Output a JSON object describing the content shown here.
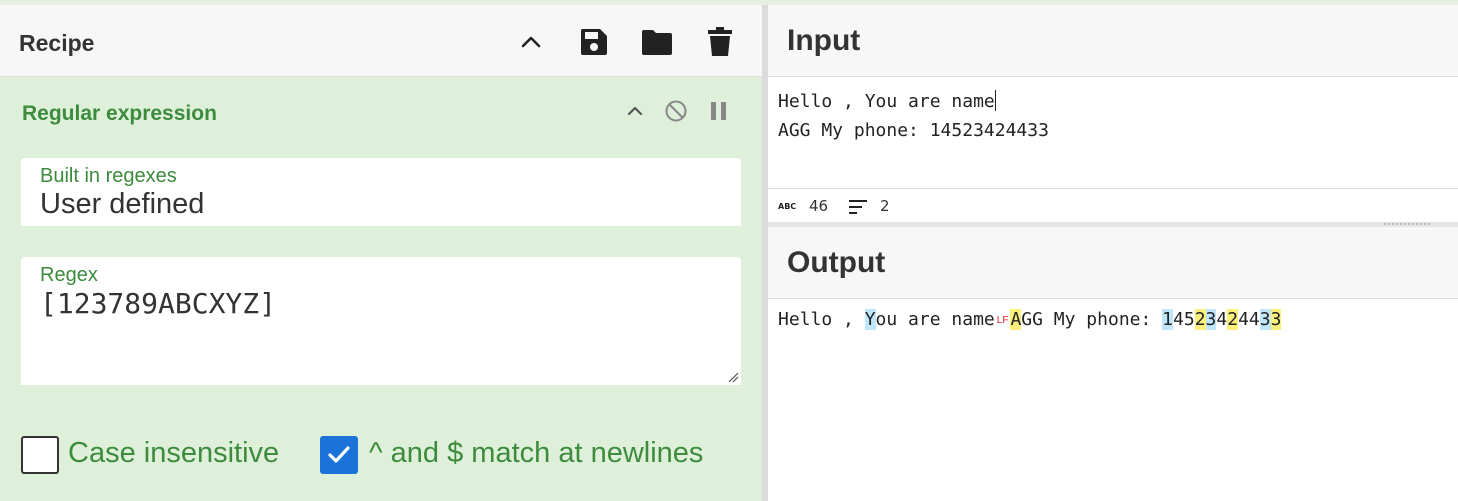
{
  "recipe": {
    "title": "Recipe",
    "header_icons": [
      "chevron-up-icon",
      "save-icon",
      "folder-icon",
      "trash-icon"
    ],
    "operation": {
      "title": "Regular expression",
      "icons": [
        "chevron-up-icon",
        "disable-icon",
        "pause-icon"
      ],
      "builtin": {
        "label": "Built in regexes",
        "value": "User defined"
      },
      "regex": {
        "label": "Regex",
        "value": "[123789ABCXYZ]"
      },
      "case_insensitive": {
        "label": "Case insensitive",
        "checked": false
      },
      "multiline": {
        "label": "^ and $ match at newlines",
        "checked": true
      }
    }
  },
  "input": {
    "title": "Input",
    "lines": [
      "Hello , You are name",
      "AGG My phone: 14523424433"
    ],
    "status": {
      "char_count": "46",
      "line_count": "2",
      "char_icon": "abc-icon",
      "lines_icon": "lines-icon"
    }
  },
  "output": {
    "title": "Output",
    "lf_marker": "LF",
    "segments": [
      {
        "text": "Hello , ",
        "hl": ""
      },
      {
        "text": "Y",
        "hl": "blue"
      },
      {
        "text": "ou are name",
        "hl": ""
      },
      {
        "text": "LF",
        "hl": "lf"
      },
      {
        "text": "A",
        "hl": "yellow"
      },
      {
        "text": "GG My phone: ",
        "hl": ""
      },
      {
        "text": "1",
        "hl": "blue"
      },
      {
        "text": "45",
        "hl": ""
      },
      {
        "text": "2",
        "hl": "yellow"
      },
      {
        "text": "3",
        "hl": "blue"
      },
      {
        "text": "4",
        "hl": ""
      },
      {
        "text": "2",
        "hl": "yellow"
      },
      {
        "text": "44",
        "hl": ""
      },
      {
        "text": "3",
        "hl": "blue"
      },
      {
        "text": "3",
        "hl": "yellow"
      }
    ]
  },
  "colors": {
    "accent_green": "#3d8b3d",
    "checkbox_blue": "#1a73d9",
    "highlight_blue": "#bfe6fb",
    "highlight_yellow": "#fbf07a"
  }
}
